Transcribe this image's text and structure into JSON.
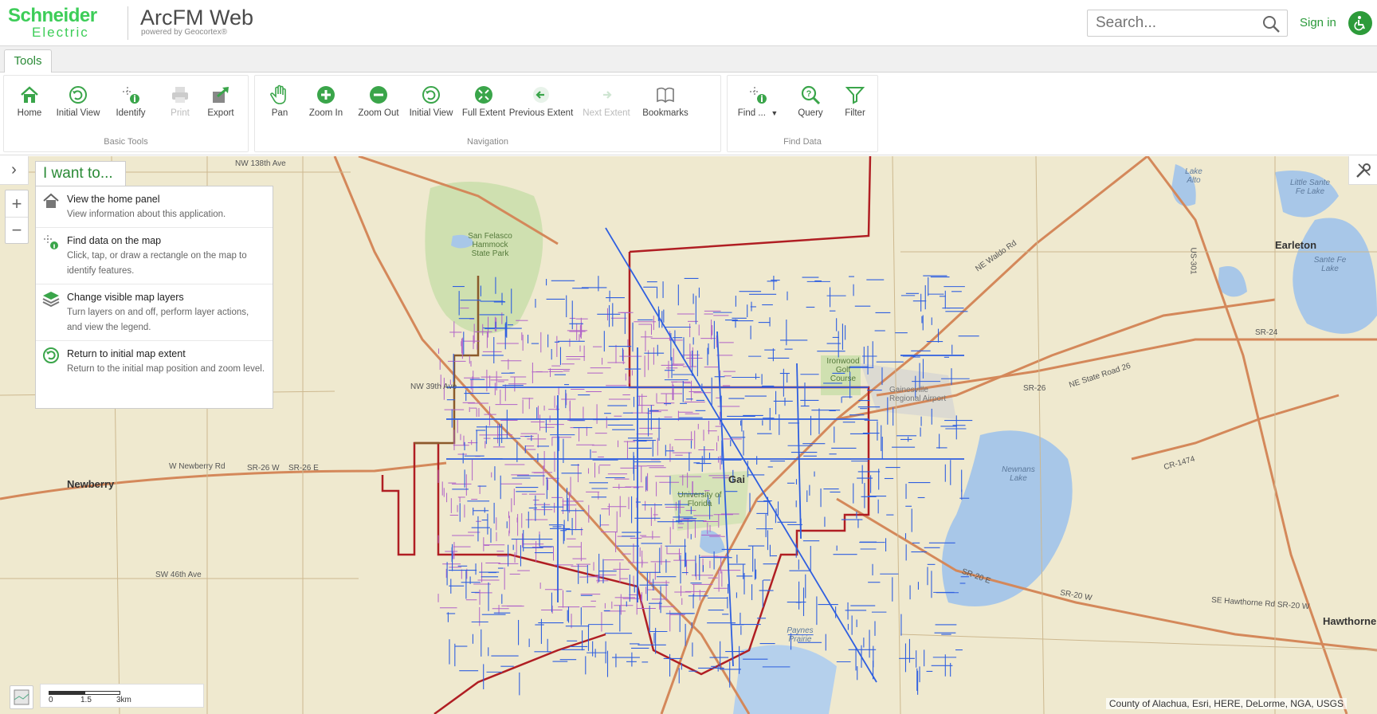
{
  "header": {
    "brand_name": "Schneider",
    "brand_sub": "Electric",
    "app_title": "ArcFM Web",
    "app_subtitle": "powered by Geocortex®",
    "search_placeholder": "Search...",
    "sign_in": "Sign in"
  },
  "tabs": [
    {
      "label": "Tools"
    }
  ],
  "toolbar": {
    "groups": [
      {
        "label": "Basic Tools",
        "tools": [
          {
            "label": "Home",
            "icon": "home-icon"
          },
          {
            "label": "Initial View",
            "icon": "refresh-icon"
          },
          {
            "label": "Identify",
            "icon": "identify-icon"
          },
          {
            "label": "Print",
            "icon": "print-icon",
            "disabled": true
          },
          {
            "label": "Export",
            "icon": "export-icon"
          }
        ]
      },
      {
        "label": "Navigation",
        "tools": [
          {
            "label": "Pan",
            "icon": "hand-icon"
          },
          {
            "label": "Zoom In",
            "icon": "zoom-in-icon"
          },
          {
            "label": "Zoom Out",
            "icon": "zoom-out-icon"
          },
          {
            "label": "Initial View",
            "icon": "refresh-icon"
          },
          {
            "label": "Full Extent",
            "icon": "full-extent-icon"
          },
          {
            "label": "Previous Extent",
            "icon": "arrow-left-icon"
          },
          {
            "label": "Next Extent",
            "icon": "arrow-right-icon",
            "disabled": true
          },
          {
            "label": "Bookmarks",
            "icon": "book-icon"
          }
        ]
      },
      {
        "label": "Find Data",
        "tools": [
          {
            "label": "Find ...",
            "icon": "find-icon"
          },
          {
            "label": "Query",
            "icon": "query-icon"
          },
          {
            "label": "Filter",
            "icon": "filter-icon"
          }
        ]
      }
    ]
  },
  "iwant": {
    "title": "I want to...",
    "items": [
      {
        "title": "View the home panel",
        "desc": "View information about this application."
      },
      {
        "title": "Find data on the map",
        "desc": "Click, tap, or draw a rectangle on the map to identify features."
      },
      {
        "title": "Change visible map layers",
        "desc": "Turn layers on and off, perform layer actions, and view the legend."
      },
      {
        "title": "Return to initial map extent",
        "desc": "Return to the initial map position and zoom level."
      }
    ]
  },
  "map": {
    "zoom_in": "+",
    "zoom_out": "−",
    "scale": {
      "labels": [
        "0",
        "1.5",
        "3km"
      ]
    },
    "attribution": "County of Alachua, Esri, HERE, DeLorme, NGA, USGS",
    "labels": {
      "newberry": "Newberry",
      "earleton": "Earleton",
      "hawthorne": "Hawthorne",
      "gainesville": "Gai",
      "san_felasco": "San Felasco Hammock State Park",
      "newnans_lake": "Newnans Lake",
      "lake_alto": "Lake Alto",
      "little_santa_fe": "Little Sante Fe Lake",
      "santa_fe_lake": "Sante Fe Lake",
      "paynes_prairie": "Paynes Prairie",
      "uf": "University of Florida",
      "ironwood": "Ironwood Golf Course",
      "airport": "Gainesville Regional Airport",
      "nw_138": "NW 138th Ave",
      "nw_39": "NW 39th Ave",
      "sw_46": "SW 46th Ave",
      "w_newberry": "W Newberry Rd",
      "sr26w": "SR-26 W",
      "sr26e": "SR-26 E",
      "sr20e": "SR-20 E",
      "sr20w": "SR-20 W",
      "se_hawthorne": "SE Hawthorne Rd SR-20 W",
      "sr26": "SR-26",
      "ne_state_road": "NE State Road 26",
      "cr1474": "CR-1474",
      "ne_waldo": "NE Waldo Rd",
      "us301": "US-301",
      "sr24": "SR-24"
    },
    "colors": {
      "background": "#efe9cf",
      "blue_network": "#2f5fe0",
      "purple_network": "#b062c8",
      "boundary": "#b01e23",
      "road": "#d4885a",
      "water": "#a8c7e8",
      "park": "#cfe0b0"
    }
  }
}
